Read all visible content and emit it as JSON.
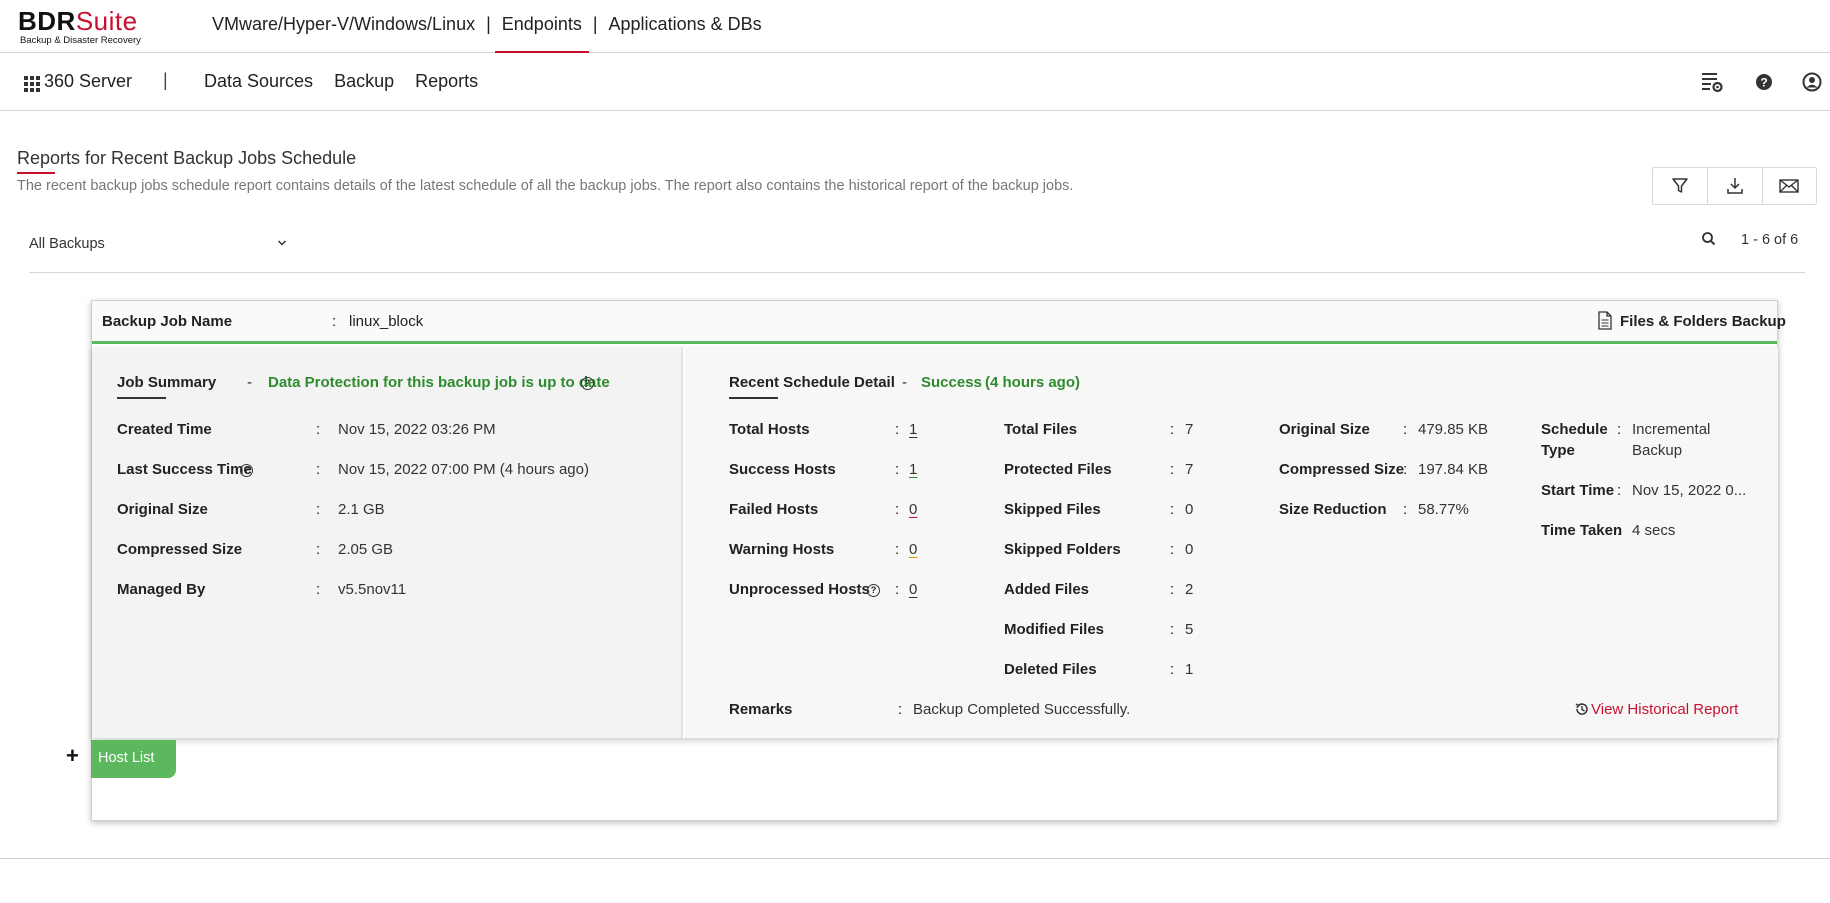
{
  "brand": {
    "name_bold": "BDR",
    "name_rest": "Suite",
    "tagline": "Backup & Disaster Recovery"
  },
  "top_nav": {
    "items": [
      "VMware/Hyper-V/Windows/Linux",
      "Endpoints",
      "Applications & DBs"
    ],
    "separator": "|",
    "active": "Endpoints"
  },
  "sub_nav": {
    "server_label": "360 Server",
    "separator": "|",
    "items": [
      "Data Sources",
      "Backup",
      "Reports"
    ]
  },
  "header_icons": [
    "report-settings-icon",
    "help-icon",
    "user-icon"
  ],
  "page": {
    "title": "Reports for Recent Backup Jobs Schedule",
    "description": "The recent backup jobs schedule report contains details of the latest schedule of all the backup jobs. The report also contains the historical report of the backup jobs.",
    "actions": [
      "filter-icon",
      "download-icon",
      "mail-icon"
    ]
  },
  "filter": {
    "selected": "All Backups",
    "pager": "1 - 6 of 6"
  },
  "card": {
    "job_name_label": "Backup Job Name",
    "colon": ":",
    "job_name": "linux_block",
    "backup_type": "Files & Folders Backup",
    "job_summary": {
      "title": "Job Summary",
      "dash": "-",
      "status": "Data Protection for this backup job is up to date",
      "rows": [
        {
          "label": "Created Time",
          "value": "Nov 15, 2022 03:26 PM"
        },
        {
          "label": "Last Success Time",
          "value": "Nov 15, 2022 07:00 PM (4 hours ago)"
        },
        {
          "label": "Original Size",
          "value": "2.1 GB"
        },
        {
          "label": "Compressed Size",
          "value": "2.05 GB"
        },
        {
          "label": "Managed By",
          "value": "v5.5nov11"
        }
      ]
    },
    "schedule": {
      "title": "Recent Schedule Detail",
      "dash": "-",
      "status": "Success",
      "status_ago": "(4 hours ago)",
      "hosts": [
        {
          "label": "Total Hosts",
          "value": "1"
        },
        {
          "label": "Success Hosts",
          "value": "1"
        },
        {
          "label": "Failed Hosts",
          "value": "0"
        },
        {
          "label": "Warning Hosts",
          "value": "0"
        },
        {
          "label": "Unprocessed Hosts",
          "value": "0"
        }
      ],
      "files": [
        {
          "label": "Total Files",
          "value": "7"
        },
        {
          "label": "Protected Files",
          "value": "7"
        },
        {
          "label": "Skipped Files",
          "value": "0"
        },
        {
          "label": "Skipped Folders",
          "value": "0"
        },
        {
          "label": "Added Files",
          "value": "2"
        },
        {
          "label": "Modified Files",
          "value": "5"
        },
        {
          "label": "Deleted Files",
          "value": "1"
        }
      ],
      "sizes": [
        {
          "label": "Original Size",
          "value": "479.85 KB"
        },
        {
          "label": "Compressed Size",
          "value": "197.84 KB"
        },
        {
          "label": "Size Reduction",
          "value": "58.77%"
        }
      ],
      "schedule_type_label_1": "Schedule",
      "schedule_type_label_2": "Type",
      "schedule_type_value_1": "Incremental",
      "schedule_type_value_2": "Backup",
      "start_time_label": "Start Time",
      "start_time_value": "Nov 15, 2022 0...",
      "time_taken_label": "Time Taken",
      "time_taken_value": "4 secs",
      "remarks_label": "Remarks",
      "remarks_value": "Backup Completed Successfully.",
      "historical_link": "View Historical Report"
    }
  },
  "host_list": {
    "toggle": "+",
    "label": "Host List"
  },
  "colors": {
    "brand_red": "#c8102e",
    "success_green": "#2e8b2e",
    "accent_green": "#5cb85c"
  }
}
